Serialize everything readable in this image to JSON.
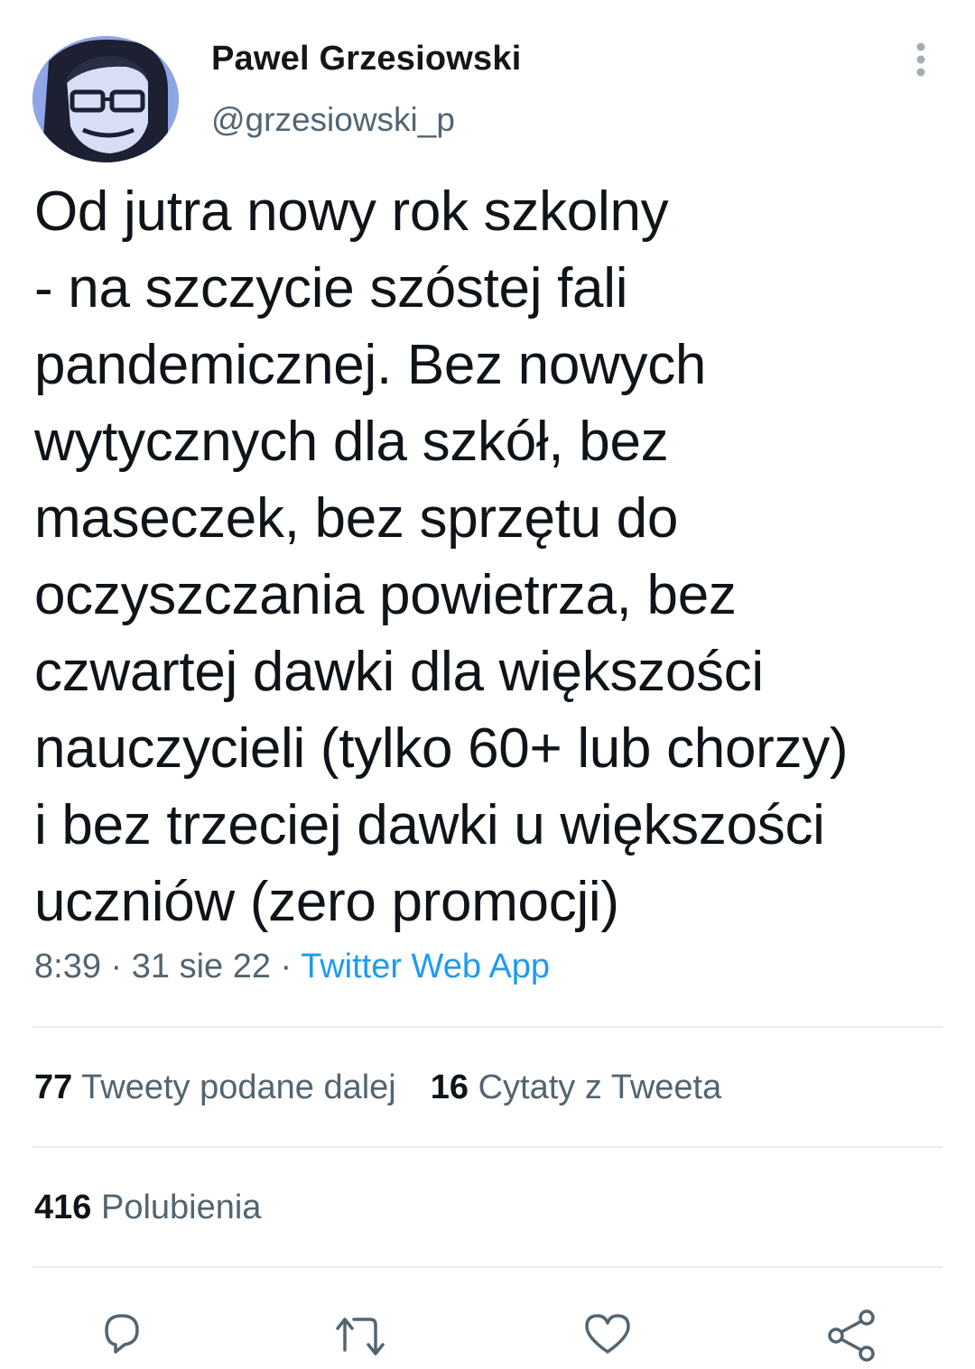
{
  "author": {
    "display_name": "Pawel Grzesiowski",
    "handle": "@grzesiowski_p"
  },
  "tweet": {
    "text": "Od jutra nowy rok szkolny\n- na szczycie szóstej fali\npandemicznej. Bez nowych\nwytycznych dla szkół, bez\nmaseczek, bez sprzętu do\noczyszczania powietrza, bez\nczwartej dawki dla większości\nnauczycieli (tylko 60+ lub chorzy)\ni bez trzeciej dawki u większości\nuczniów (zero promocji)",
    "time": "8:39",
    "date": "31 sie 22",
    "separator": "·",
    "source": "Twitter Web App"
  },
  "stats": {
    "retweets_count": "77",
    "retweets_label": "Tweety podane dalej",
    "quotes_count": "16",
    "quotes_label": "Cytaty z Tweeta",
    "likes_count": "416",
    "likes_label": "Polubienia"
  },
  "icons": {
    "more": "more-vertical-icon",
    "reply": "reply-icon",
    "retweet": "retweet-icon",
    "like": "heart-icon",
    "share": "share-icon"
  },
  "colors": {
    "text_primary": "#0f1419",
    "text_secondary": "#536471",
    "link": "#1d9bf0",
    "divider": "#e8ecef",
    "avatar_bg": "#8fa6e6"
  }
}
